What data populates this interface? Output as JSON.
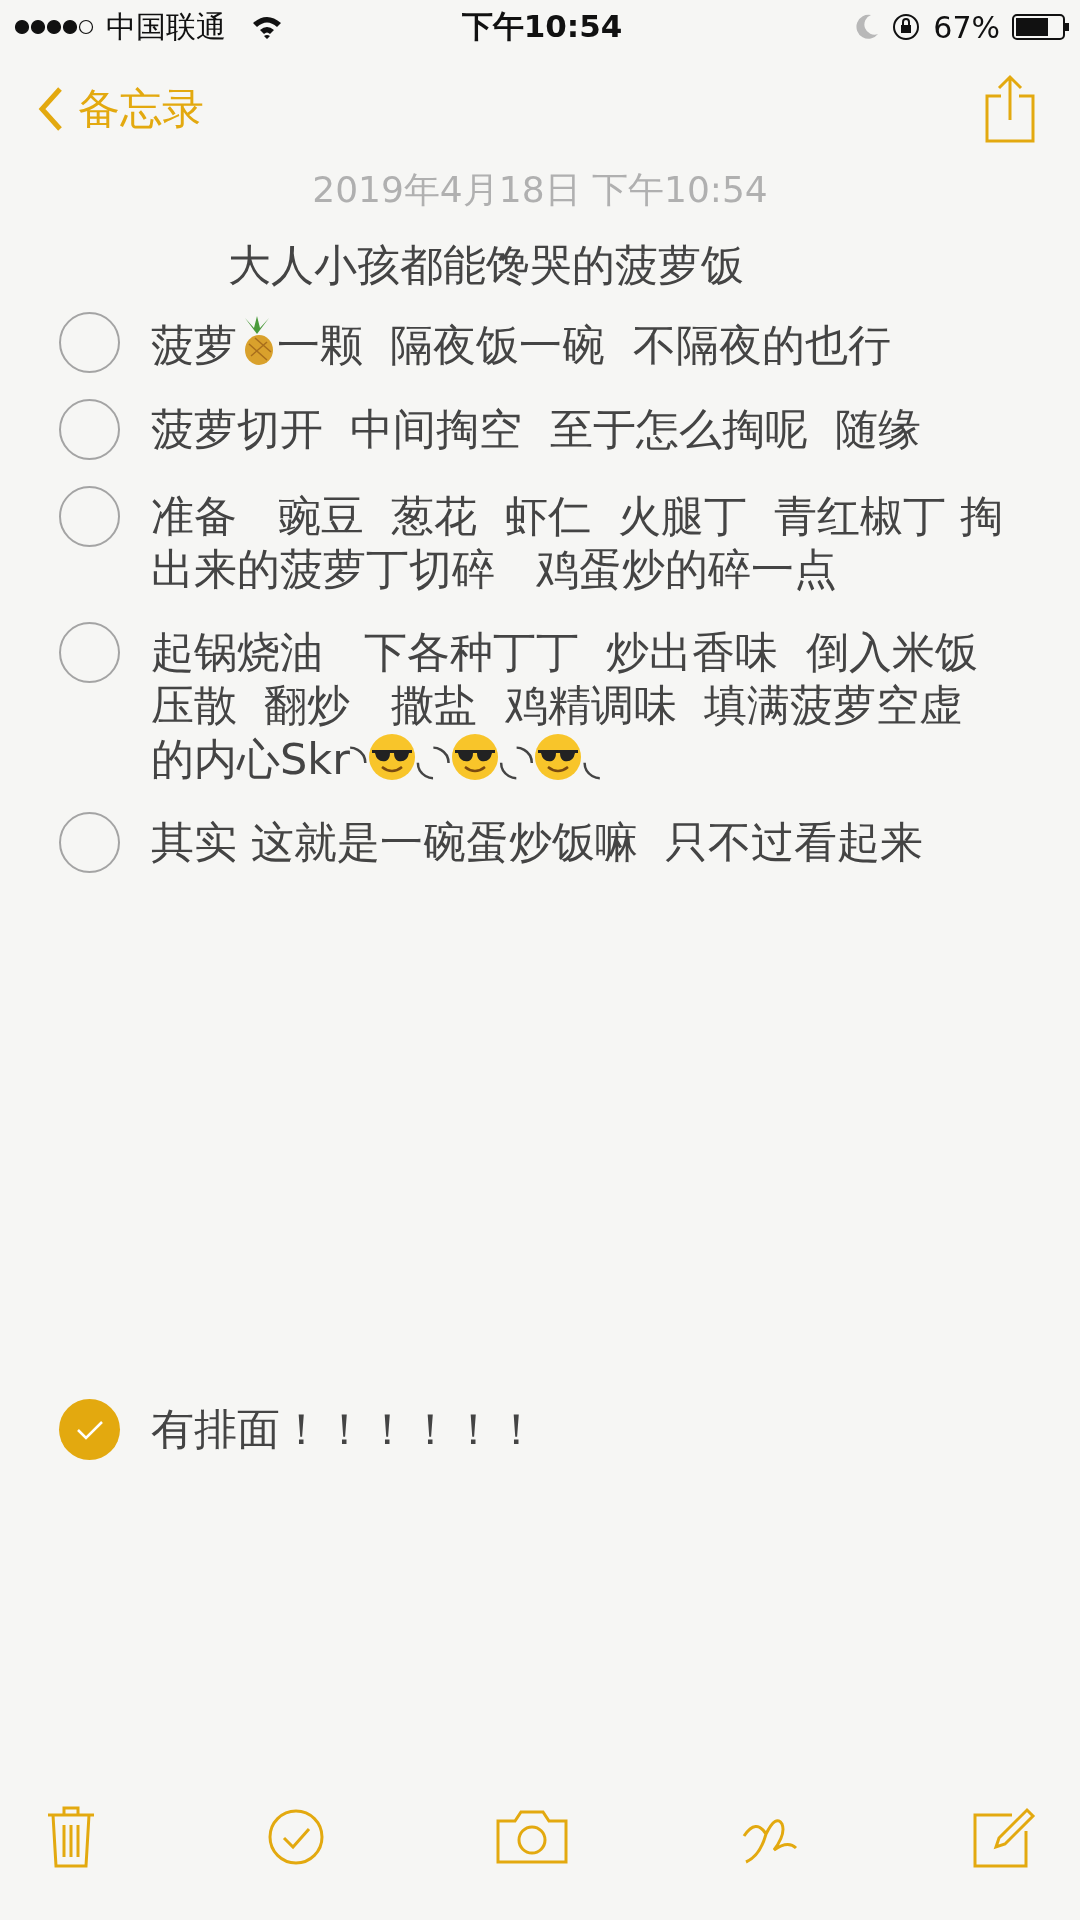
{
  "status_bar": {
    "carrier": "中国联通",
    "time": "下午10:54",
    "battery": "67%"
  },
  "nav": {
    "back_label": "备忘录"
  },
  "note": {
    "date": "2019年4月18日 下午10:54",
    "title": "大人小孩都能馋哭的菠萝饭",
    "items": [
      {
        "checked": false,
        "segments": [
          {
            "kind": "text",
            "text": "菠萝"
          },
          {
            "kind": "pineapple"
          },
          {
            "kind": "text",
            "text": "一颗  隔夜饭一碗  不隔夜的也行"
          }
        ]
      },
      {
        "checked": false,
        "segments": [
          {
            "kind": "text",
            "text": "菠萝切开  中间掏空  至于怎么掏呢  随缘"
          }
        ]
      },
      {
        "checked": false,
        "segments": [
          {
            "kind": "text",
            "text": "准备   豌豆  葱花  虾仁  火腿丁  青红椒丁 掏出来的菠萝丁切碎   鸡蛋炒的碎一点"
          }
        ]
      },
      {
        "checked": false,
        "segments": [
          {
            "kind": "line",
            "text": "起锅烧油   下各种丁丁  炒出香味  倒入米饭"
          },
          {
            "kind": "line",
            "text": "压散  翻炒   撒盐  鸡精调味  填满菠萝空虚"
          },
          {
            "kind": "text",
            "text": "的内心Skr◝"
          },
          {
            "kind": "cool"
          },
          {
            "kind": "text",
            "text": "◟◝"
          },
          {
            "kind": "cool"
          },
          {
            "kind": "text",
            "text": "◟◝"
          },
          {
            "kind": "cool"
          },
          {
            "kind": "text",
            "text": "◟"
          }
        ]
      },
      {
        "checked": false,
        "segments": [
          {
            "kind": "text",
            "text": "其实 这就是一碗蛋炒饭嘛  只不过看起来"
          }
        ]
      }
    ],
    "later_items": [
      {
        "checked": true,
        "segments": [
          {
            "kind": "text",
            "text": "有排面！！！！！！"
          }
        ]
      }
    ]
  }
}
